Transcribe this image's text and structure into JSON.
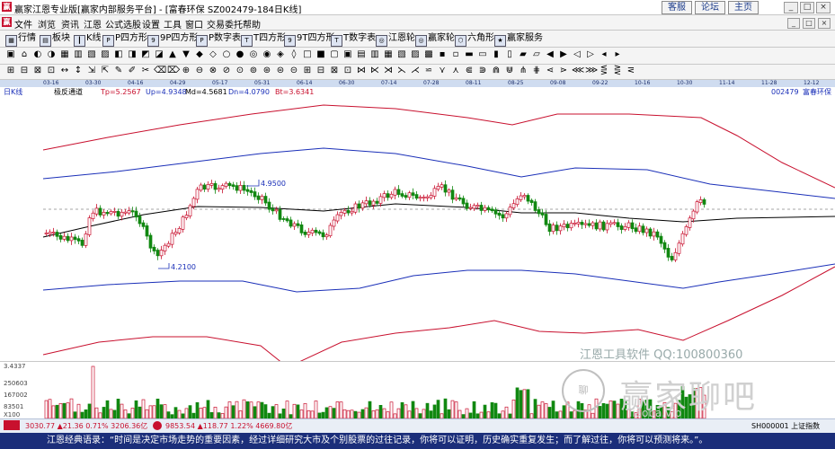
{
  "window": {
    "title": "赢家江恩专业版[赢家内部服务平台] - [富春环保  SZ002479-184日K线]",
    "links": [
      "客服",
      "论坛",
      "主页"
    ],
    "controls": [
      "_",
      "□",
      "×"
    ]
  },
  "menu": {
    "items": [
      "文件",
      "浏览",
      "资讯",
      "江恩",
      "公式选股",
      "设置",
      "工具",
      "窗口",
      "交易委托",
      "帮助"
    ],
    "controls": [
      "_",
      "□",
      "×"
    ]
  },
  "toolbar": {
    "items": [
      "行情",
      "板块",
      "K线",
      "P四方形",
      "9P四方形",
      "P数字表",
      "T四方形",
      "9T四方形",
      "T数字表",
      "江恩轮",
      "赢家轮",
      "六角形",
      "赢家服务"
    ]
  },
  "chart_header": {
    "period": "日K线",
    "indicator": "极反通道",
    "tp": "Tp=5.2567",
    "up": "Up=4.9348",
    "md": "Md=4.5681",
    "dn": "Dn=4.0790",
    "bt": "Bt=3.6341",
    "code": "002479",
    "name": "富春环保"
  },
  "dates": [
    "03-16",
    "03-30",
    "04-16",
    "04-29",
    "05-17",
    "05-31",
    "06-14",
    "06-30",
    "07-14",
    "07-28",
    "08-11",
    "08-25",
    "09-08",
    "09-22",
    "10-16",
    "10-30",
    "11-14",
    "11-28",
    "12-12"
  ],
  "annotations": {
    "high": "4.9500",
    "low": "4.2100"
  },
  "volume": {
    "labels": [
      "3.4337",
      "250603",
      "167002",
      "83501",
      "X100"
    ],
    "watermark_tool": "江恩工具软件  QQ:100800360",
    "watermark_logo": "赢家聊吧",
    "watermark_url": "liaoba.vip"
  },
  "index_bar": {
    "sh": "3030.77 ▲21.36 0.71% 3206.36亿",
    "sz": "9853.54 ▲118.77 1.22% 4669.80亿",
    "right": "SH000001 上证指数"
  },
  "quote": "江恩经典语录：“时间是决定市场走势的重要因素，经过详细研究大市及个别股票的过往记录，你将可以证明，历史确实重复发生；而了解过往，你将可以预测将来。”。",
  "colors": {
    "outer_band": "#c8102e",
    "inner_band": "#1a2fb8",
    "mid_line": "#000000",
    "up_candle": "#c8102e",
    "down_candle": "#118811",
    "quote_bg": "#1b2e7a"
  }
}
